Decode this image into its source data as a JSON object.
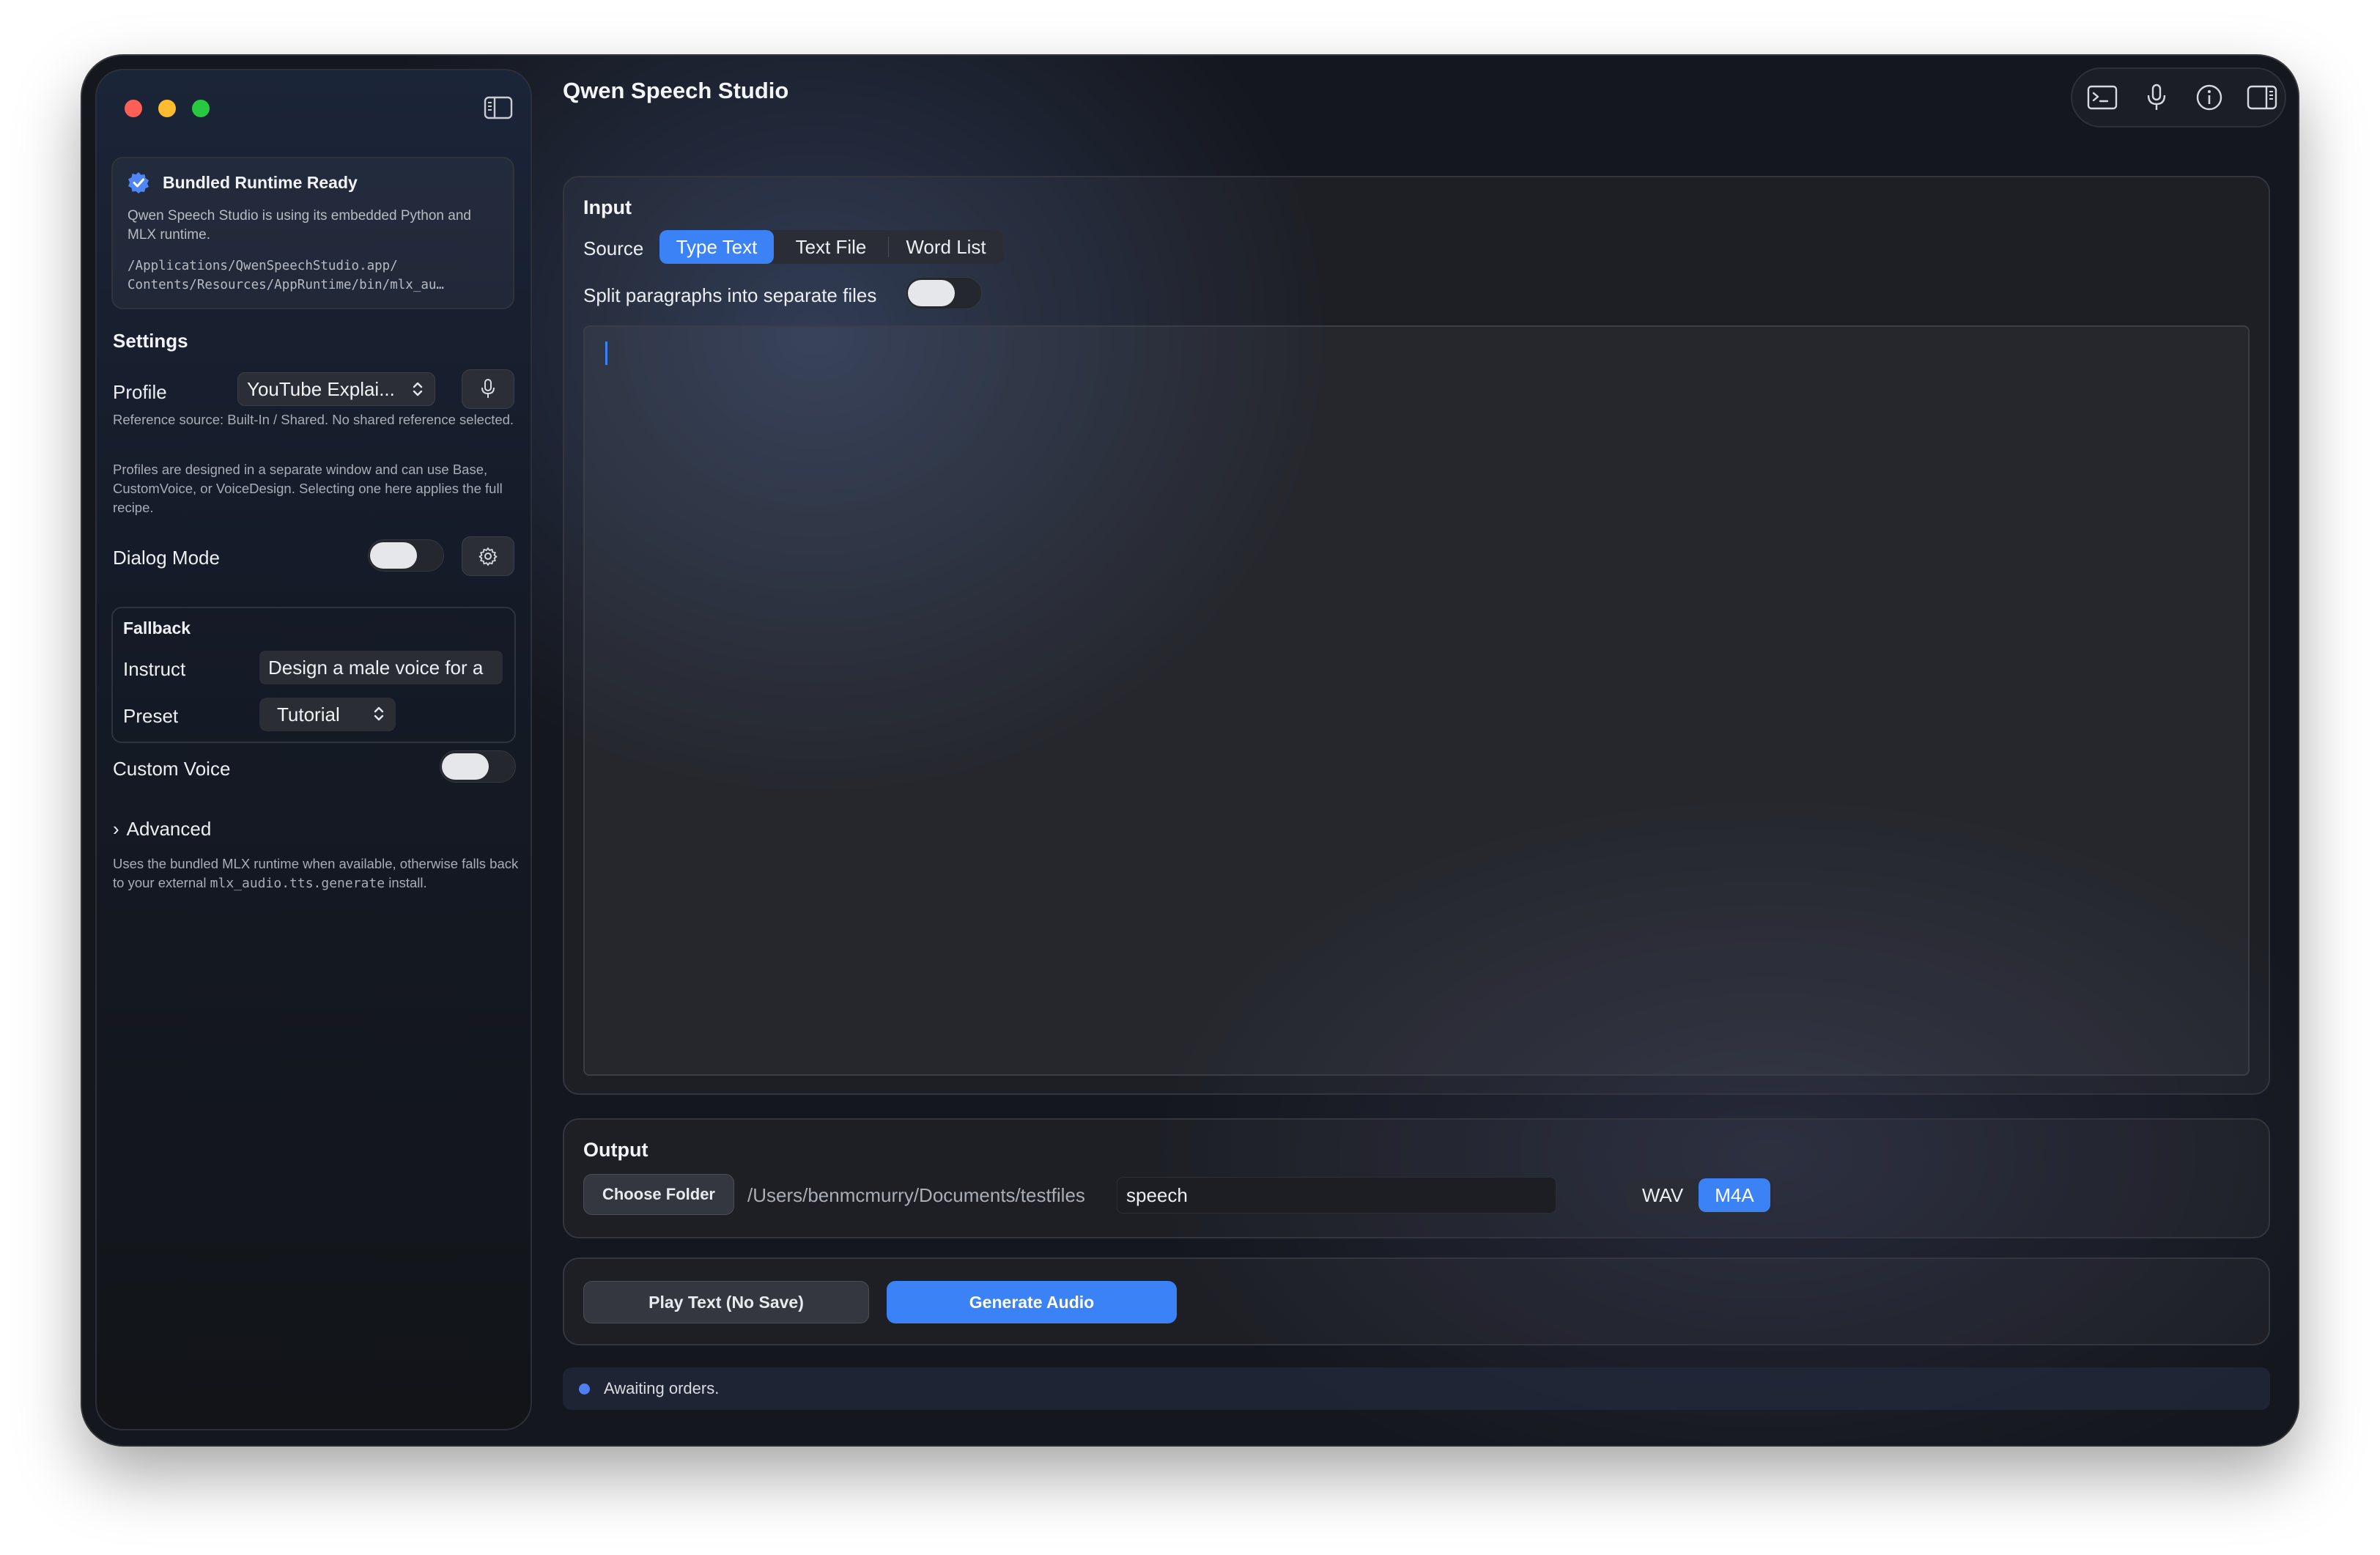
{
  "window": {
    "title": "Qwen Speech Studio"
  },
  "sidebar": {
    "runtime": {
      "title": "Bundled Runtime Ready",
      "description": "Qwen Speech Studio is using its embedded Python and MLX runtime.",
      "path": "/Applications/QwenSpeechStudio.app/\nContents/Resources/AppRuntime/bin/mlx_au…"
    },
    "settings_heading": "Settings",
    "profile": {
      "label": "Profile",
      "value": "YouTube Explai...",
      "note_reference": "Reference source: Built-In / Shared. No shared reference selected.",
      "note_profiles": "Profiles are designed in a separate window and can use Base, CustomVoice, or VoiceDesign. Selecting one here applies the full recipe."
    },
    "dialog_mode": {
      "label": "Dialog Mode",
      "enabled": false
    },
    "fallback": {
      "heading": "Fallback",
      "instruct_label": "Instruct",
      "instruct_value": "Design a male voice for a",
      "preset_label": "Preset",
      "preset_value": "Tutorial"
    },
    "custom_voice": {
      "label": "Custom Voice",
      "enabled": false
    },
    "advanced": {
      "label": "Advanced",
      "arrow": "›"
    },
    "footer_note": {
      "before": "Uses the bundled MLX runtime when available, otherwise falls back to your external ",
      "code": "mlx_audio.tts.generate",
      "after": " install."
    }
  },
  "toolbar": {
    "icons": [
      "terminal-icon",
      "microphone-icon",
      "info-icon",
      "inspector-toggle-icon"
    ]
  },
  "input": {
    "heading": "Input",
    "source_label": "Source",
    "source_options": [
      "Type Text",
      "Text File",
      "Word List"
    ],
    "source_selected": "Type Text",
    "split_label": "Split paragraphs into separate files",
    "split_enabled": false,
    "text_value": ""
  },
  "output": {
    "heading": "Output",
    "choose_folder_label": "Choose Folder",
    "folder_path": "/Users/benmcmurry/Documents/testfiles",
    "filename_value": "speech",
    "formats": [
      "WAV",
      "M4A"
    ],
    "format_selected": "M4A"
  },
  "actions": {
    "play_label": "Play Text (No Save)",
    "generate_label": "Generate Audio"
  },
  "status": {
    "text": "Awaiting orders.",
    "dot_color": "#4f7ff0"
  },
  "colors": {
    "accent": "#3b82f6",
    "traffic_red": "#fe5f57",
    "traffic_yellow": "#febc2e",
    "traffic_green": "#28c840"
  }
}
